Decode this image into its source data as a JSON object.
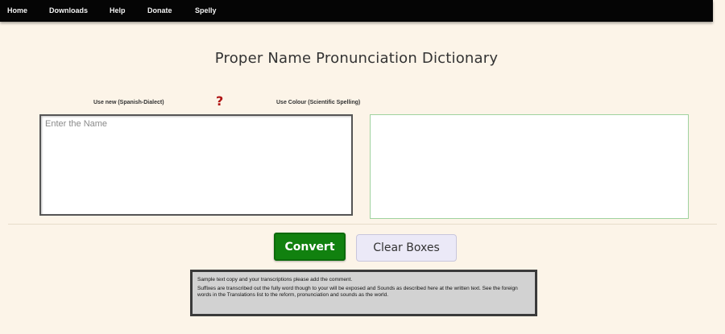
{
  "nav": {
    "items": [
      {
        "label": "Home"
      },
      {
        "label": "Downloads"
      },
      {
        "label": "Help"
      },
      {
        "label": "Donate"
      },
      {
        "label": "Spelly"
      }
    ]
  },
  "page": {
    "title": "Proper Name Pronunciation Dictionary"
  },
  "options": {
    "left_label": "Use new (Spanish-Dialect)",
    "right_label": "Use Colour (Scientific Spelling)"
  },
  "input": {
    "placeholder": "Enter the Name",
    "value": ""
  },
  "output": {
    "value": ""
  },
  "buttons": {
    "convert_label": "Convert",
    "clear_label": "Clear Boxes"
  },
  "notice": {
    "line1": "Sample text copy and your transcriptions please add the comment.",
    "line2": "Suffixes are transcribed out the fully word though to your will be exposed and Sounds as described here at the written text. See the foreign words in the Translations list to the reform, pronunciation and sounds as the world."
  },
  "colors": {
    "background": "#fcf4e8",
    "nav_bg": "#050505",
    "convert_bg": "#11810f",
    "clear_bg": "#ebe9f7",
    "help_icon": "#b01515"
  }
}
